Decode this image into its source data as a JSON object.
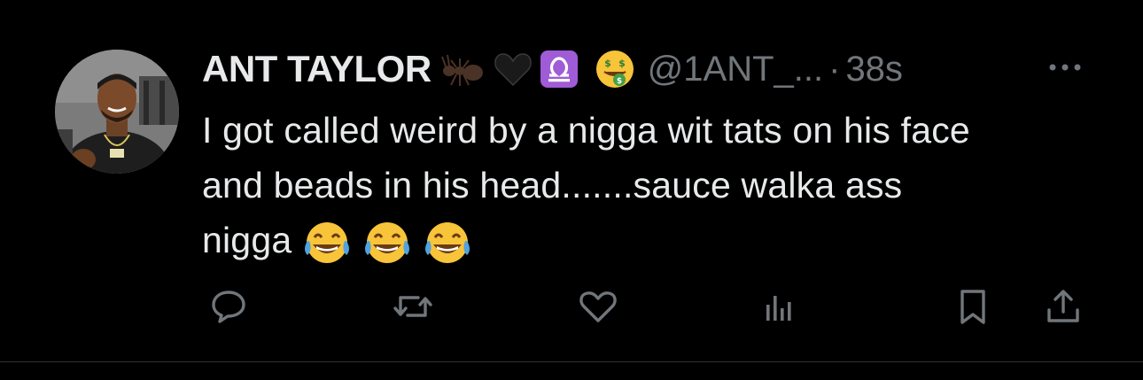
{
  "tweet": {
    "author": {
      "display_name": "ANT TAYLOR",
      "handle": "@1ANT_...",
      "badges": [
        "ant-emoji",
        "black-heart-emoji",
        "libra-emoji",
        "money-mouth-face-emoji"
      ]
    },
    "separator": "·",
    "timestamp": "38s",
    "text_lines": [
      "I got called weird by a nigga wit tats on his face",
      "and beads in his head.......sauce walka ass",
      "nigga"
    ],
    "trailing_emojis": [
      "face-with-tears-of-joy-emoji",
      "face-with-tears-of-joy-emoji",
      "face-with-tears-of-joy-emoji"
    ],
    "actions": [
      "reply-icon",
      "retweet-icon",
      "like-icon",
      "views-icon",
      "bookmark-icon",
      "share-icon"
    ]
  },
  "colors": {
    "background": "#000000",
    "primary_text": "#e7e9ea",
    "secondary_text": "#71767b",
    "divider": "#2f3336",
    "libra_purple": "#a05bd6",
    "emoji_yellow": "#f7c43a"
  }
}
